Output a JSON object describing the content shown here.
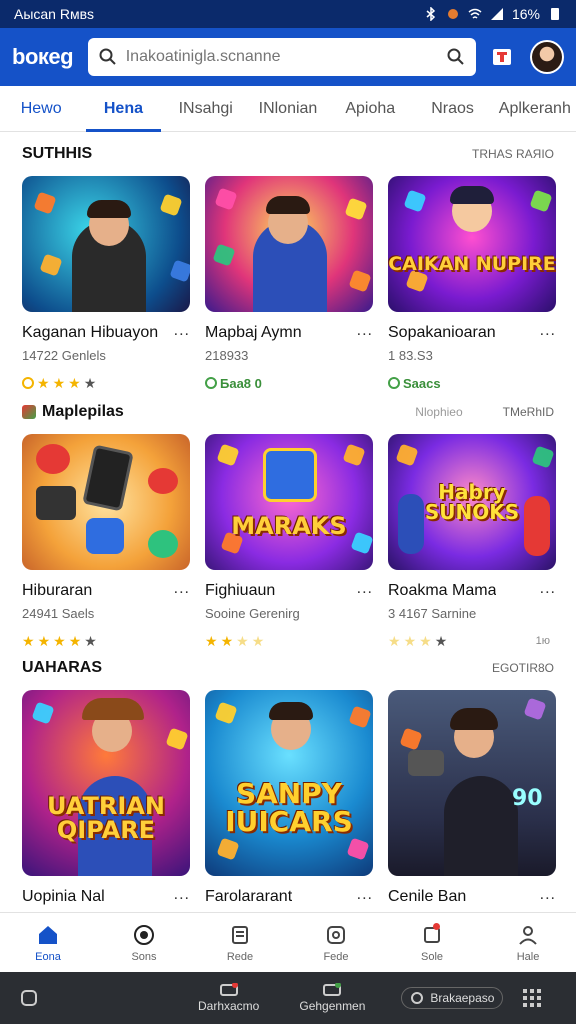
{
  "status": {
    "left": "Aысаn Rмвs",
    "right": "16%"
  },
  "header": {
    "logo": "bокeg",
    "search_placeholder": "Inakoatinigla.scnanne"
  },
  "tabs": [
    "Hewo",
    "Hena",
    "INsahgi",
    "INlonian",
    "Apioha",
    "Nraos",
    "Aplkeranh"
  ],
  "sections": [
    {
      "title": "SUTHHIS",
      "more": "TRНAS RAЯIO",
      "extra": "",
      "cards": [
        {
          "title": "Kaganan Hibuayon",
          "sub": "14722 Genlels",
          "rating_text": "",
          "stars": 3,
          "rating_num": ""
        },
        {
          "title": "Mapbaj Aymn",
          "sub": "218933",
          "rating_text": "Бaa8 0",
          "stars": 0,
          "rating_num": ""
        },
        {
          "title": "Sopakanioaran",
          "sub": "1 83.S3",
          "rating_text": "Saacs",
          "stars": 0,
          "rating_num": ""
        }
      ]
    },
    {
      "title": "Maplepilas",
      "more": "TMeRhID",
      "extra": "Nlophieo",
      "cards": [
        {
          "title": "Hiburaran",
          "sub": "24941 Saels",
          "rating_text": "",
          "stars": 4,
          "rating_num": ""
        },
        {
          "title": "Fighiuaun",
          "sub": "Sooine Gerenirg",
          "rating_text": "",
          "stars": 2,
          "rating_num": ""
        },
        {
          "title": "Roakma Mama",
          "sub": "3 4167 Sarnine",
          "rating_text": "",
          "stars": 1,
          "rating_num": "1ю"
        }
      ]
    },
    {
      "title": "UAHARAS",
      "more": "EGOTIR8О",
      "extra": "",
      "cards": [
        {
          "title": "Uopinia Nal",
          "sub": "",
          "rating_text": "",
          "stars": 0,
          "rating_num": ""
        },
        {
          "title": "Farolararant",
          "sub": "",
          "rating_text": "",
          "stars": 0,
          "rating_num": ""
        },
        {
          "title": "Cenile Ban",
          "sub": "",
          "rating_text": "",
          "stars": 0,
          "rating_num": ""
        }
      ]
    }
  ],
  "thumb_texts": {
    "s1c3": "CAIKAN NUPIRE",
    "s2c2": "MARAKS",
    "s2c3": "Habry SUNOKS",
    "s3c1": "UATRIAN QIPARE",
    "s3c2": "SANPY IUICARS",
    "s3c3": "90"
  },
  "bottom_nav": [
    "Eona",
    "Sons",
    "Rede",
    "Fede",
    "Sole",
    "Hale"
  ],
  "system_bar": {
    "item1": "Darhxacmo",
    "item2": "Gehgenmen",
    "pill": "Brakaepaso"
  },
  "colors": {
    "primary": "#1552c8",
    "status": "#0b2a6b",
    "star": "#f4b400"
  }
}
